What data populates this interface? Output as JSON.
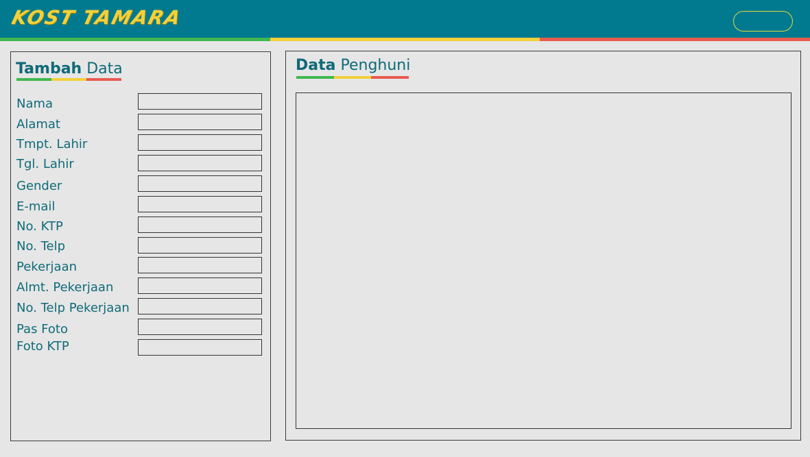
{
  "header": {
    "logo_text": "KOST TAMARA",
    "bg_color": "#017a8f",
    "logo_color": "#f2d13a"
  },
  "stripe_colors": [
    "#3fb84f",
    "#f2d13a",
    "#e85a4f"
  ],
  "form_panel": {
    "title_bold": "Tambah",
    "title_rest": "Data",
    "fields": [
      {
        "label": "Nama",
        "value": ""
      },
      {
        "label": "Alamat",
        "value": ""
      },
      {
        "label": "Tmpt. Lahir",
        "value": ""
      },
      {
        "label": "Tgl. Lahir",
        "value": ""
      },
      {
        "label": "Gender",
        "value": ""
      },
      {
        "label": "E-mail",
        "value": ""
      },
      {
        "label": "No. KTP",
        "value": ""
      },
      {
        "label": "No. Telp",
        "value": ""
      },
      {
        "label": "Pekerjaan",
        "value": ""
      },
      {
        "label": "Almt. Pekerjaan",
        "value": ""
      },
      {
        "label": "No. Telp Pekerjaan",
        "value": ""
      },
      {
        "label": "Pas Foto",
        "value": ""
      },
      {
        "label": "Foto KTP",
        "value": ""
      }
    ]
  },
  "data_panel": {
    "title_bold": "Data",
    "title_rest": "Penghuni"
  }
}
